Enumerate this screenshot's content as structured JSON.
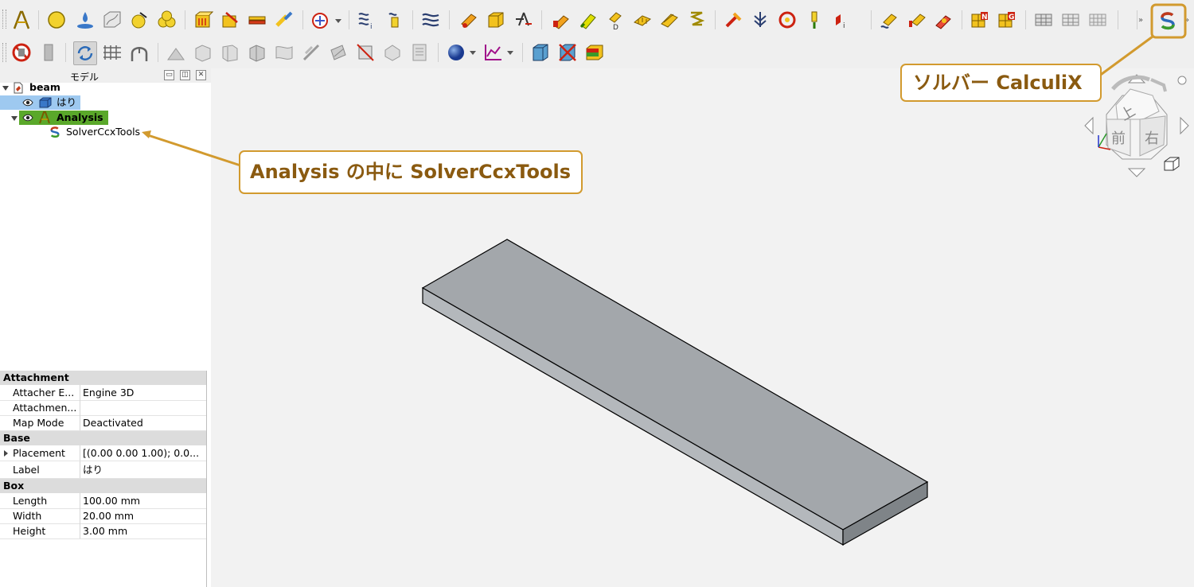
{
  "toolbar_top": {
    "icons": [
      "fem-workbench-icon",
      "analysis-container-icon",
      "material-solid-icon",
      "material-fluid-icon",
      "material-nonlinear-icon",
      "material-mix-icon",
      "fixed-constraint-icon",
      "displacement-constraint-icon",
      "contact-constraint-icon",
      "tie-constraint-icon",
      "rigid-body-icon",
      "heatflux-icon",
      "initial-temperature-icon",
      "fluid-section-icon",
      "beam-section-icon",
      "shell-section-icon",
      "spring-icon",
      "force-constraint-icon",
      "pressure-constraint-icon",
      "centrif-icon",
      "self-weight-icon",
      "bearing-icon",
      "temperature-constraint-icon",
      "heat-constraint-icon",
      "body-heat-icon",
      "mesh-netgen-icon",
      "mesh-gmsh-icon",
      "mesh-group-icon",
      "mesh-region-icon",
      "mesh-boundary-layer-icon",
      "solver-calculix-icon"
    ],
    "solver_button_label": "SolverCcxTools",
    "overflow_label": "»"
  },
  "toolbar_second": {
    "icons": [
      "fem-stop-icon",
      "fem-clear-icon",
      "fem-refresh-icon",
      "mesh-display-icon",
      "result-display-icon",
      "post-pipeline-icon",
      "post-filter-clip-icon",
      "post-filter-cut-icon",
      "post-filter-scalar-icon",
      "post-filter-warp-icon",
      "post-data-along-line-icon",
      "post-data-at-point-icon",
      "post-filter-contours-icon",
      "post-glyph-icon",
      "post-calculator-icon",
      "sphere-icon",
      "plot-icon",
      "view-box-icon",
      "view-delete-icon",
      "color-cube-icon"
    ]
  },
  "tree": {
    "title": "モデル",
    "root_label": "beam",
    "items": [
      {
        "label": "はり",
        "selected": true
      },
      {
        "label": "Analysis",
        "highlighted": true
      },
      {
        "label": "SolverCcxTools"
      }
    ]
  },
  "properties": {
    "groups": [
      {
        "name": "Attachment",
        "rows": [
          {
            "name": "Attacher E...",
            "value": "Engine 3D"
          },
          {
            "name": "Attachmen...",
            "value": ""
          },
          {
            "name": "Map Mode",
            "value": "Deactivated"
          }
        ]
      },
      {
        "name": "Base",
        "rows": [
          {
            "name": "Placement",
            "value": "[(0.00 0.00 1.00); 0.0..."
          },
          {
            "name": "Label",
            "value": "はり"
          }
        ]
      },
      {
        "name": "Box",
        "rows": [
          {
            "name": "Length",
            "value": "100.00 mm"
          },
          {
            "name": "Width",
            "value": "20.00 mm"
          },
          {
            "name": "Height",
            "value": "3.00 mm"
          }
        ]
      }
    ]
  },
  "navcube": {
    "top_label": "上",
    "front_label": "前",
    "right_label": "右"
  },
  "callouts": {
    "solver": "ソルバー CalculiX",
    "analysis": "Analysis の中に SolverCcxTools"
  },
  "colors": {
    "accent": "#d29a2e",
    "callout_text": "#8a5a10",
    "selection": "#9ec9f0",
    "analysis_highlight": "#5aa82a",
    "beam_top": "#a3a7ab",
    "beam_side": "#7f8488"
  }
}
